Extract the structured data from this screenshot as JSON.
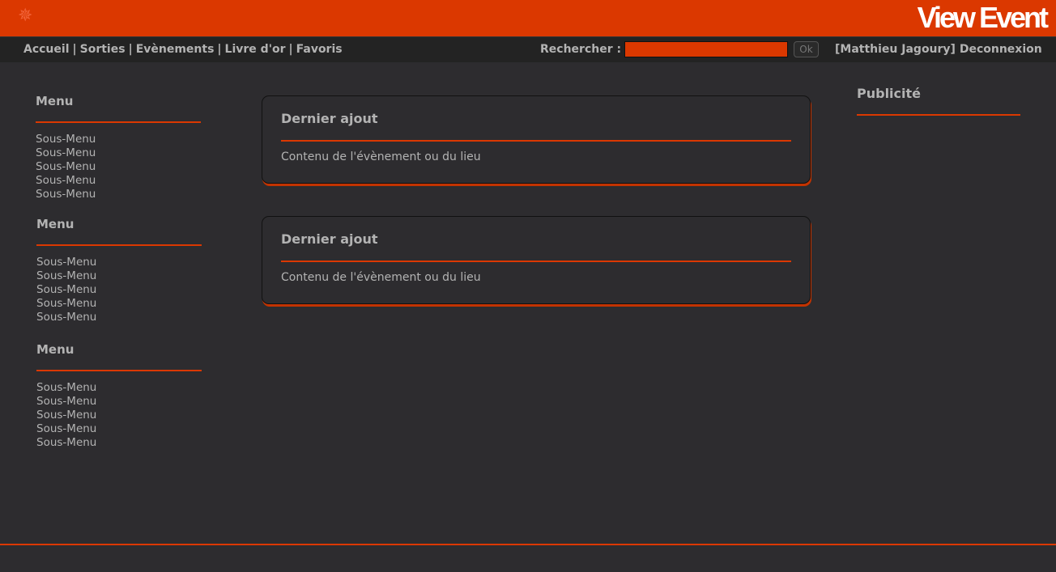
{
  "header": {
    "logo": "View Event",
    "icon": "gear-icon",
    "accent": "#db3800"
  },
  "nav": {
    "links": [
      "Accueil",
      "Sorties",
      "Evènements",
      "Livre d'or",
      "Favoris"
    ],
    "separator": "|",
    "search_label": "Rechercher :",
    "search_value": "",
    "ok_label": "Ok",
    "user": "[Matthieu Jagoury]",
    "logout": "Deconnexion"
  },
  "sidebar": {
    "menus": [
      {
        "title": "Menu",
        "items": [
          "Sous-Menu",
          "Sous-Menu",
          "Sous-Menu",
          "Sous-Menu",
          "Sous-Menu"
        ]
      },
      {
        "title": "Menu",
        "items": [
          "Sous-Menu",
          "Sous-Menu",
          "Sous-Menu",
          "Sous-Menu",
          "Sous-Menu"
        ]
      },
      {
        "title": "Menu",
        "items": [
          "Sous-Menu",
          "Sous-Menu",
          "Sous-Menu",
          "Sous-Menu",
          "Sous-Menu"
        ]
      }
    ]
  },
  "main": {
    "cards": [
      {
        "title": "Dernier ajout",
        "content": "Contenu de l'évènement ou du lieu"
      },
      {
        "title": "Dernier ajout",
        "content": "Contenu de l'évènement ou du lieu"
      }
    ]
  },
  "ads": {
    "title": "Publicité"
  }
}
